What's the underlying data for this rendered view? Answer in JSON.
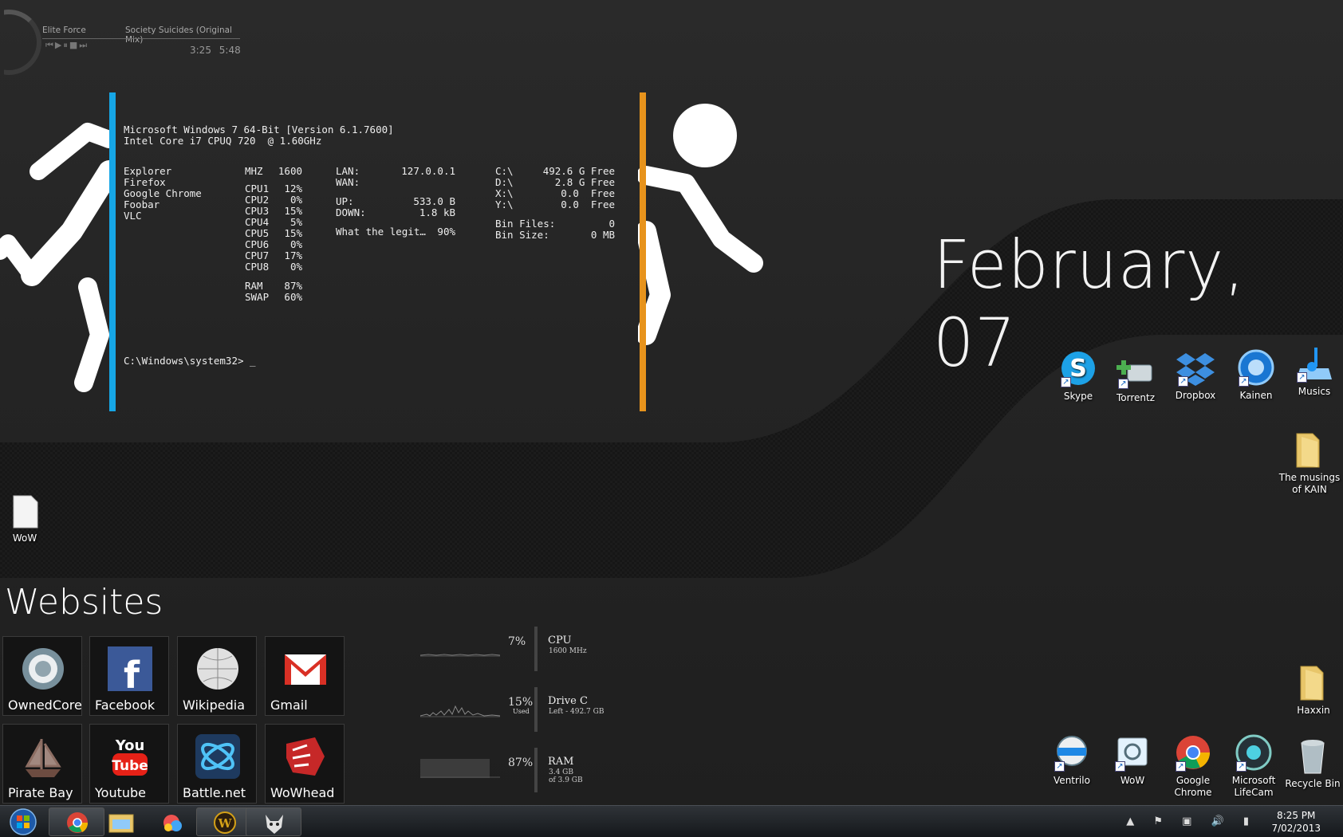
{
  "player": {
    "artist": "Elite Force",
    "song": "Society Suicides (Original Mix)",
    "controls": "⏮▶⏸■⏭",
    "elapsed": "3:25",
    "total": "5:48"
  },
  "console": {
    "os_line": "Microsoft Windows 7 64-Bit [Version 6.1.7600]",
    "cpu_line": "Intel Core i7 CPUQ 720  @ 1.60GHz",
    "processes": [
      "Explorer",
      "Firefox",
      "Google Chrome",
      "Foobar",
      "VLC"
    ],
    "mhz_label": "MHZ",
    "mhz_value": "1600",
    "cpu_cores": [
      {
        "label": "CPU1",
        "value": "12%"
      },
      {
        "label": "CPU2",
        "value": "0%"
      },
      {
        "label": "CPU3",
        "value": "15%"
      },
      {
        "label": "CPU4",
        "value": "5%"
      },
      {
        "label": "CPU5",
        "value": "15%"
      },
      {
        "label": "CPU6",
        "value": "0%"
      },
      {
        "label": "CPU7",
        "value": "17%"
      },
      {
        "label": "CPU8",
        "value": "0%"
      }
    ],
    "ram_label": "RAM",
    "ram_value": "87%",
    "swap_label": "SWAP",
    "swap_value": "60%",
    "lan_label": "LAN:",
    "lan_value": "127.0.0.1",
    "wan_label": "WAN:",
    "wan_value": "",
    "up_label": "UP:",
    "up_value": "533.0 B",
    "down_label": "DOWN:",
    "down_value": "1.8 kB",
    "extra_label": "What the legit…",
    "extra_value": "90%",
    "drives": [
      {
        "label": "C:\\",
        "value": "492.6 G Free"
      },
      {
        "label": "D:\\",
        "value": "2.8 G Free"
      },
      {
        "label": "X:\\",
        "value": "0.0  Free"
      },
      {
        "label": "Y:\\",
        "value": "0.0  Free"
      }
    ],
    "bin_files_label": "Bin Files:",
    "bin_files_value": "0",
    "bin_size_label": "Bin Size:",
    "bin_size_value": "0 MB",
    "prompt": "C:\\Windows\\system32> _"
  },
  "date": "February, 07",
  "desktop_icons_top": [
    {
      "label": "Skype",
      "icon": "skype-icon",
      "color": "#1da1e6"
    },
    {
      "label": "Torrentz",
      "icon": "torrentz-icon",
      "color": "#8bc34a"
    },
    {
      "label": "Dropbox",
      "icon": "dropbox-icon",
      "color": "#3d8fe0"
    },
    {
      "label": "Kainen",
      "icon": "kainen-icon",
      "color": "#2aa0e8"
    },
    {
      "label": "Musics",
      "icon": "music-folder-icon",
      "color": "#4aa8e8"
    }
  ],
  "folder_musings": "The musings of KAIN",
  "file_wow": "WoW",
  "folder_haxxin": "Haxxin",
  "desktop_icons_bottom": [
    {
      "label": "Ventrilo",
      "icon": "ventrilo-icon"
    },
    {
      "label": "WoW",
      "icon": "wow-icon"
    },
    {
      "label": "Google Chrome",
      "icon": "chrome-icon"
    },
    {
      "label": "Microsoft LifeCam",
      "icon": "lifecam-icon"
    },
    {
      "label": "Recycle Bin",
      "icon": "recycle-bin-icon"
    }
  ],
  "websites": {
    "title": "Websites",
    "tiles": [
      {
        "label": "OwnedCore",
        "icon": "ownedcore-icon"
      },
      {
        "label": "Facebook",
        "icon": "facebook-icon"
      },
      {
        "label": "Wikipedia",
        "icon": "wikipedia-icon"
      },
      {
        "label": "Gmail",
        "icon": "gmail-icon"
      },
      {
        "label": "Pirate Bay",
        "icon": "pirate-bay-icon"
      },
      {
        "label": "Youtube",
        "icon": "youtube-icon"
      },
      {
        "label": "Battle.net",
        "icon": "battlenet-icon"
      },
      {
        "label": "WoWhead",
        "icon": "wowhead-icon"
      }
    ]
  },
  "meters": [
    {
      "name": "CPU",
      "pct": "7%",
      "sub1": "1600 MHz",
      "sub2": "",
      "fill": 0.07
    },
    {
      "name": "Drive C",
      "pct": "15%",
      "pct_sub": "Used",
      "sub1": "Left - 492.7 GB",
      "sub2": "",
      "fill": 0.15
    },
    {
      "name": "RAM",
      "pct": "87%",
      "sub1": "3.4 GB",
      "sub2": "of 3.9 GB",
      "fill": 0.87
    }
  ],
  "taskbar": {
    "apps": [
      "chrome-icon",
      "explorer-icon",
      "paint-icon",
      "wow-icon",
      "foobar-icon"
    ],
    "tray": "▲ ⚑ ▣ 🔊 ▮",
    "time": "8:25 PM",
    "date": "7/02/2013"
  }
}
